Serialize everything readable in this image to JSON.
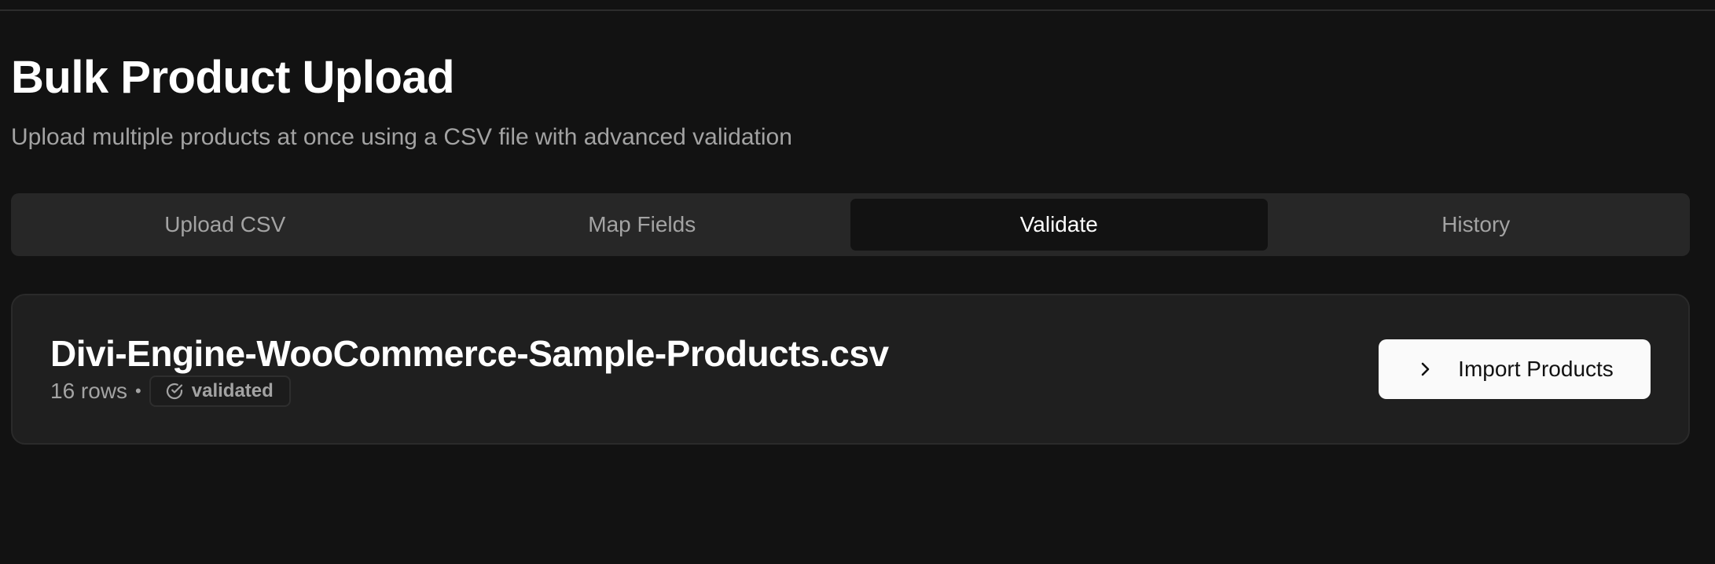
{
  "page": {
    "title": "Bulk Product Upload",
    "subtitle": "Upload multiple products at once using a CSV file with advanced validation"
  },
  "tabs": [
    {
      "label": "Upload CSV",
      "active": false
    },
    {
      "label": "Map Fields",
      "active": false
    },
    {
      "label": "Validate",
      "active": true
    },
    {
      "label": "History",
      "active": false
    }
  ],
  "file": {
    "name": "Divi-Engine-WooCommerce-Sample-Products.csv",
    "row_count": "16 rows",
    "separator": "•",
    "status": "validated",
    "status_icon": "check-circle-icon"
  },
  "actions": {
    "import_label": "Import Products",
    "import_icon": "chevron-right-icon"
  },
  "colors": {
    "background": "#121212",
    "card": "#1f1f1f",
    "tab_bar": "#272727",
    "muted_text": "#a3a3a3",
    "primary_button": "#fafafa"
  }
}
